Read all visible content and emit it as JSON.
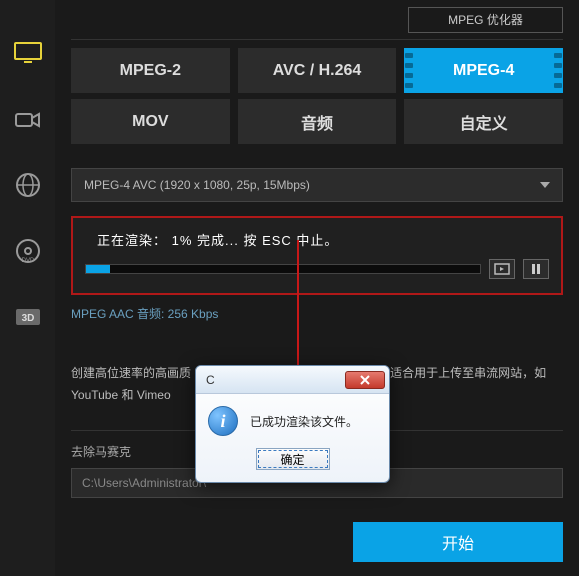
{
  "header": {
    "optimizer_label": "MPEG 优化器"
  },
  "sidebar": {
    "items": [
      {
        "name": "monitor-icon"
      },
      {
        "name": "camcorder-icon"
      },
      {
        "name": "globe-icon"
      },
      {
        "name": "disc-icon"
      },
      {
        "name": "three-d-icon"
      }
    ]
  },
  "tabs": {
    "row1": [
      {
        "label": "MPEG-2",
        "active": false
      },
      {
        "label": "AVC / H.264",
        "active": false
      },
      {
        "label": "MPEG-4",
        "active": true
      }
    ],
    "row2": [
      {
        "label": "MOV",
        "active": false
      },
      {
        "label": "音频",
        "active": false
      },
      {
        "label": "自定义",
        "active": false
      }
    ]
  },
  "format_dropdown": {
    "selected": "MPEG-4 AVC (1920 x 1080, 25p, 15Mbps)"
  },
  "render": {
    "status_text": "正在渲染：  1% 完成... 按 ESC 中止。",
    "progress_percent": 6,
    "audio_info": "MPEG AAC 音频: 256 Kbps"
  },
  "description": "创建高位速率的高画质 MPEG-4 AVC 视频文件。此设置文件适合用于上传至串流网站，如 YouTube 和 Vimeo",
  "mosaic": {
    "label": "去除马赛克"
  },
  "output_path": {
    "value": "C:\\Users\\Administrator\\"
  },
  "footer": {
    "start_label": "开始"
  },
  "dialog": {
    "title": "C",
    "message": "已成功渲染该文件。",
    "ok_label": "确定"
  }
}
